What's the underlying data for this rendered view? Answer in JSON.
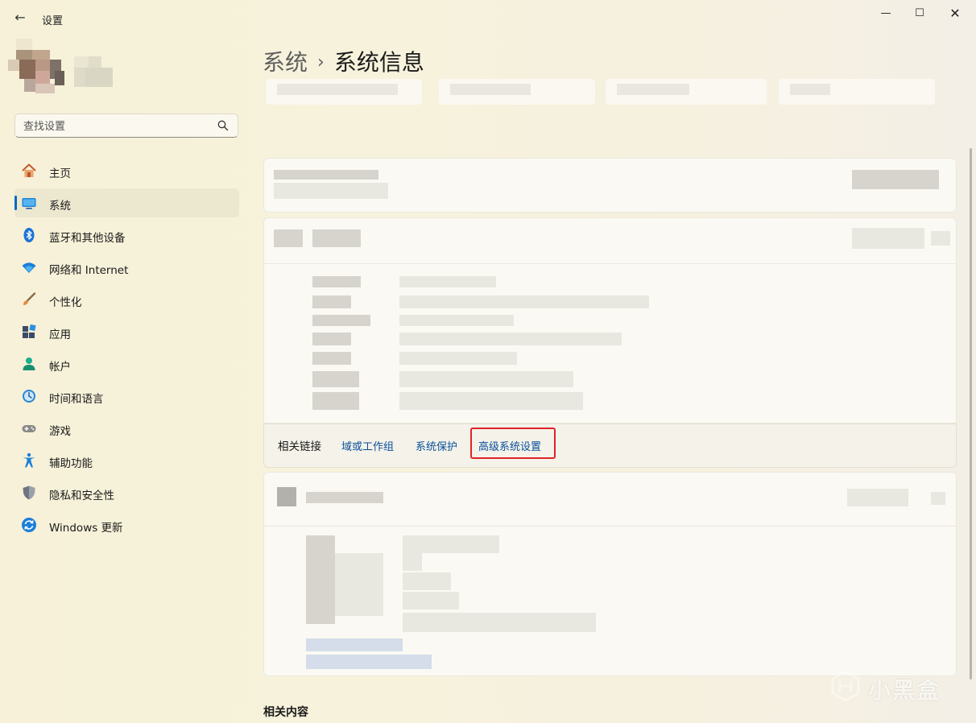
{
  "window": {
    "app_title": "设置",
    "back_label": "←",
    "minimize_label": "—",
    "maximize_label": "☐",
    "close_label": "✕"
  },
  "search": {
    "placeholder": "查找设置"
  },
  "nav": {
    "items": [
      {
        "label": "主页",
        "icon": "home-icon",
        "active": false
      },
      {
        "label": "系统",
        "icon": "system-display-icon",
        "active": true
      },
      {
        "label": "蓝牙和其他设备",
        "icon": "bluetooth-icon",
        "active": false
      },
      {
        "label": "网络和 Internet",
        "icon": "wifi-icon",
        "active": false
      },
      {
        "label": "个性化",
        "icon": "brush-icon",
        "active": false
      },
      {
        "label": "应用",
        "icon": "apps-icon",
        "active": false
      },
      {
        "label": "帐户",
        "icon": "account-icon",
        "active": false
      },
      {
        "label": "时间和语言",
        "icon": "time-language-icon",
        "active": false
      },
      {
        "label": "游戏",
        "icon": "gamepad-icon",
        "active": false
      },
      {
        "label": "辅助功能",
        "icon": "accessibility-icon",
        "active": false
      },
      {
        "label": "隐私和安全性",
        "icon": "shield-icon",
        "active": false
      },
      {
        "label": "Windows 更新",
        "icon": "windows-update-icon",
        "active": false
      }
    ]
  },
  "breadcrumb": {
    "parent": "系统",
    "separator": "›",
    "current": "系统信息"
  },
  "related_links": {
    "title": "相关链接",
    "links": [
      "域或工作组",
      "系统保护",
      "高级系统设置"
    ],
    "highlighted": "高级系统设置"
  },
  "related_content": {
    "title": "相关内容"
  },
  "watermark": {
    "text": "小黑盒"
  },
  "colors": {
    "accent": "#0067c0",
    "link": "#0a4f9c",
    "highlight_border": "#e0232b",
    "nav_active_bg": "#ece7cf"
  }
}
